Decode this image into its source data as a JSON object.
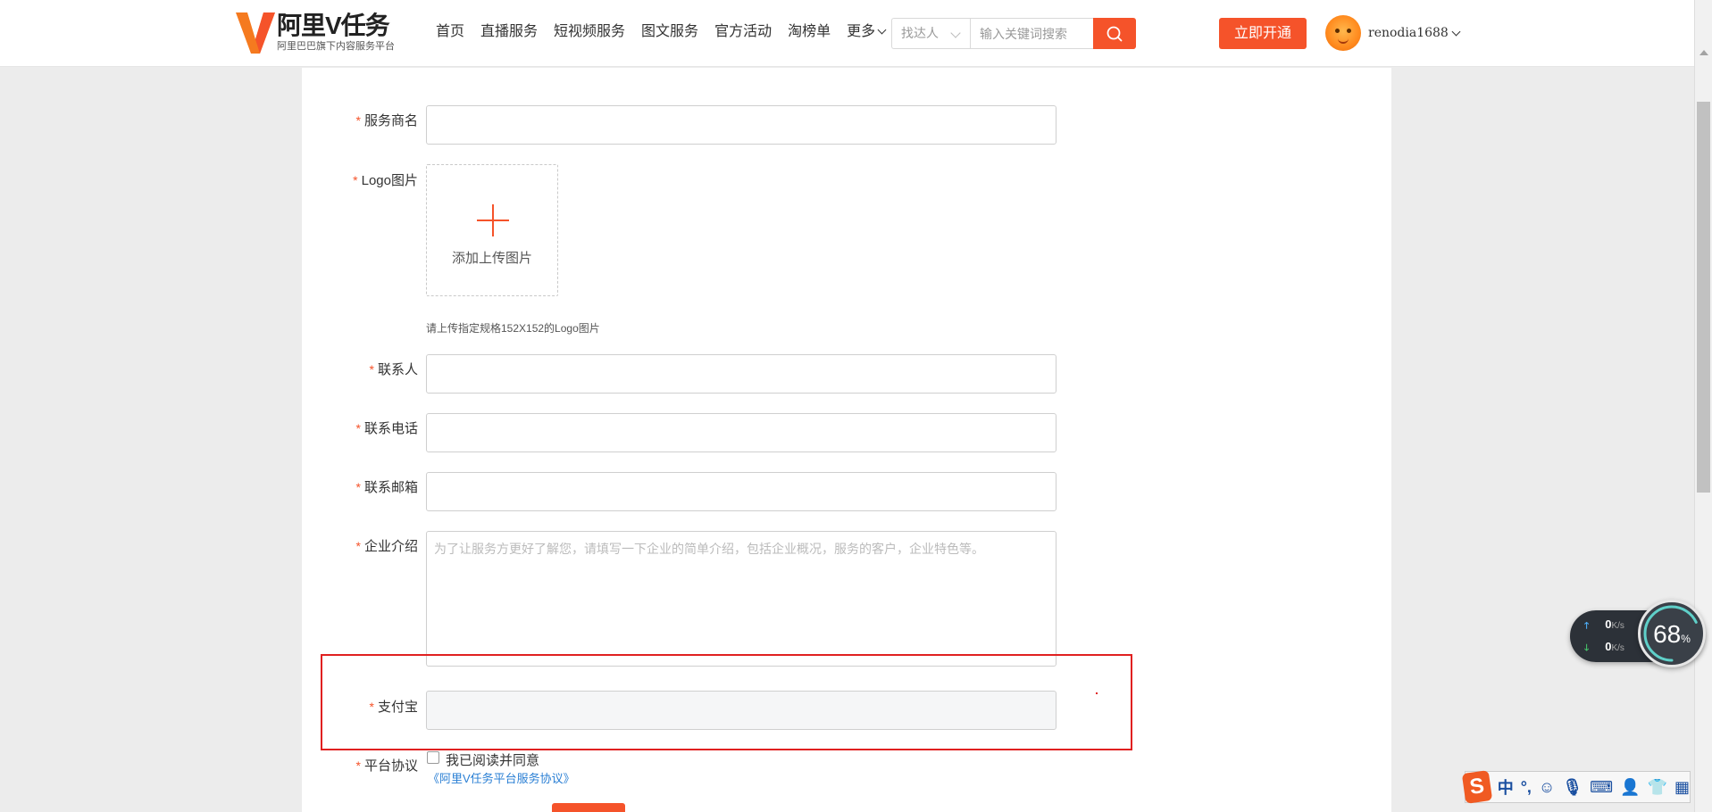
{
  "header": {
    "logo_title": "阿里V任务",
    "logo_sub": "阿里巴巴旗下内容服务平台",
    "nav": [
      "首页",
      "直播服务",
      "短视频服务",
      "图文服务",
      "官方活动",
      "淘榜单"
    ],
    "more_label": "更多",
    "search_type": "找达人",
    "search_placeholder": "输入关键词搜索",
    "open_button": "立即开通",
    "username": "renodia1688"
  },
  "form": {
    "service_name_label": "服务商名",
    "logo_label": "Logo图片",
    "upload_text": "添加上传图片",
    "logo_hint": "请上传指定规格152X152的Logo图片",
    "contact_label": "联系人",
    "phone_label": "联系电话",
    "email_label": "联系邮箱",
    "intro_label": "企业介绍",
    "intro_placeholder": "为了让服务方更好了解您，请填写一下企业的简单介绍，包括企业概况，服务的客户，企业特色等。",
    "alipay_label": "支付宝",
    "agreement_label": "平台协议",
    "agree_text": "我已阅读并同意",
    "agreement_link": "《阿里V任务平台服务协议》",
    "required_mark": "*"
  },
  "net_widget": {
    "up": "0",
    "down": "0",
    "unit": "K/s",
    "percent": "68",
    "percent_sign": "%",
    "percent_value": 68
  },
  "ime": {
    "logo": "S",
    "mode": "中",
    "punct": "°,"
  }
}
